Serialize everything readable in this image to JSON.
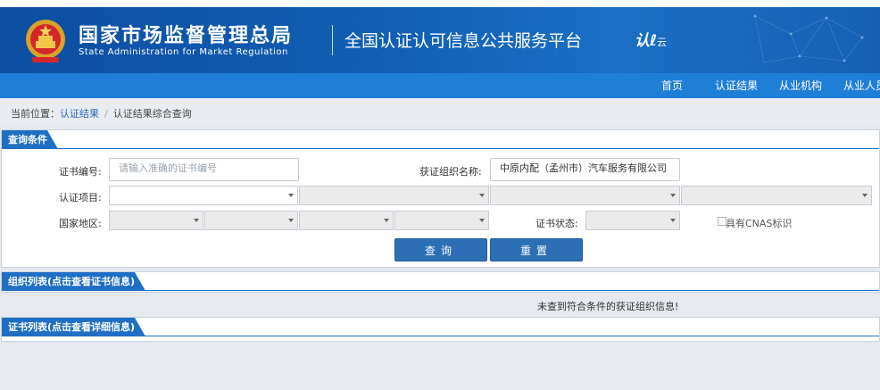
{
  "header": {
    "agency_cn": "国家市场监督管理总局",
    "agency_en": "State Administration  for  Market Regulation",
    "platform_title": "全国认证认可信息公共服务平台",
    "logo_text": "认",
    "logo_text2": "云"
  },
  "nav": {
    "items": [
      "首页",
      "认证结果",
      "从业机构",
      "从业人员"
    ]
  },
  "breadcrumb": {
    "prefix": "当前位置：",
    "link": "认证结果",
    "separator": "/",
    "current": "认证结果综合查询"
  },
  "query_panel": {
    "title": "查询条件",
    "cert_no_label": "证书编号:",
    "cert_no_placeholder": "请输入准确的证书编号",
    "org_name_label": "获证组织名称:",
    "org_name_value": "中原内配（孟州市）汽车服务有限公司",
    "cert_item_label": "认证项目:",
    "region_label": "国家地区:",
    "status_label": "证书状态:",
    "cnas_label": "具有CNAS标识",
    "search_button": "查询",
    "reset_button": "重置"
  },
  "org_panel": {
    "title": "组织列表(点击查看证书信息)",
    "empty_message": "未查到符合条件的获证组织信息!"
  },
  "cert_panel": {
    "title": "证书列表(点击查看详细信息)"
  },
  "colors": {
    "header_blue": "#0c4ea1",
    "nav_blue": "#1f7fd6",
    "panel_title_blue": "#1f6fc4",
    "button_blue": "#2c6fb7"
  }
}
